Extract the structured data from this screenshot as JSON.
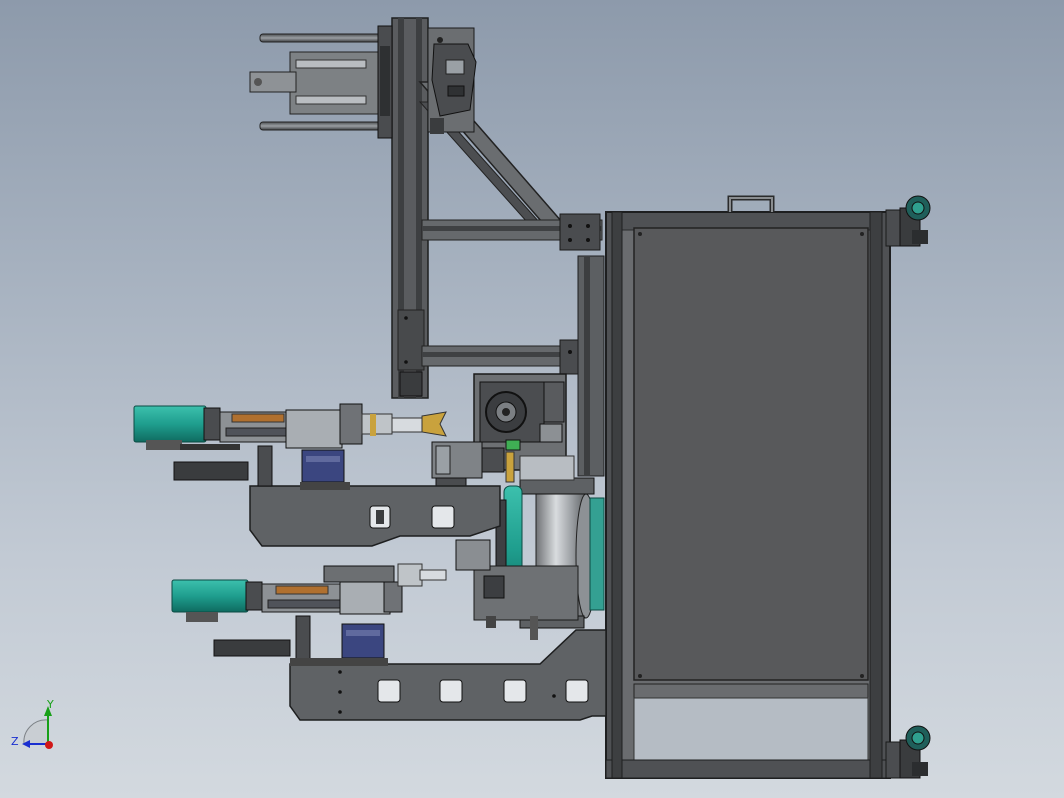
{
  "axis_triad": {
    "y_label": "Y",
    "z_label": "Z",
    "colors": {
      "y": "#18a018",
      "z": "#1a2fd0",
      "x": "#d01818"
    }
  },
  "palette": {
    "frame": "#5d5f62",
    "frame_dark": "#3a3c3e",
    "panel": "#575859",
    "motor_teal": "#1f9e8e",
    "drive_blue": "#3b4680",
    "accent_brass": "#c9a23d",
    "copper": "#b0702f"
  }
}
